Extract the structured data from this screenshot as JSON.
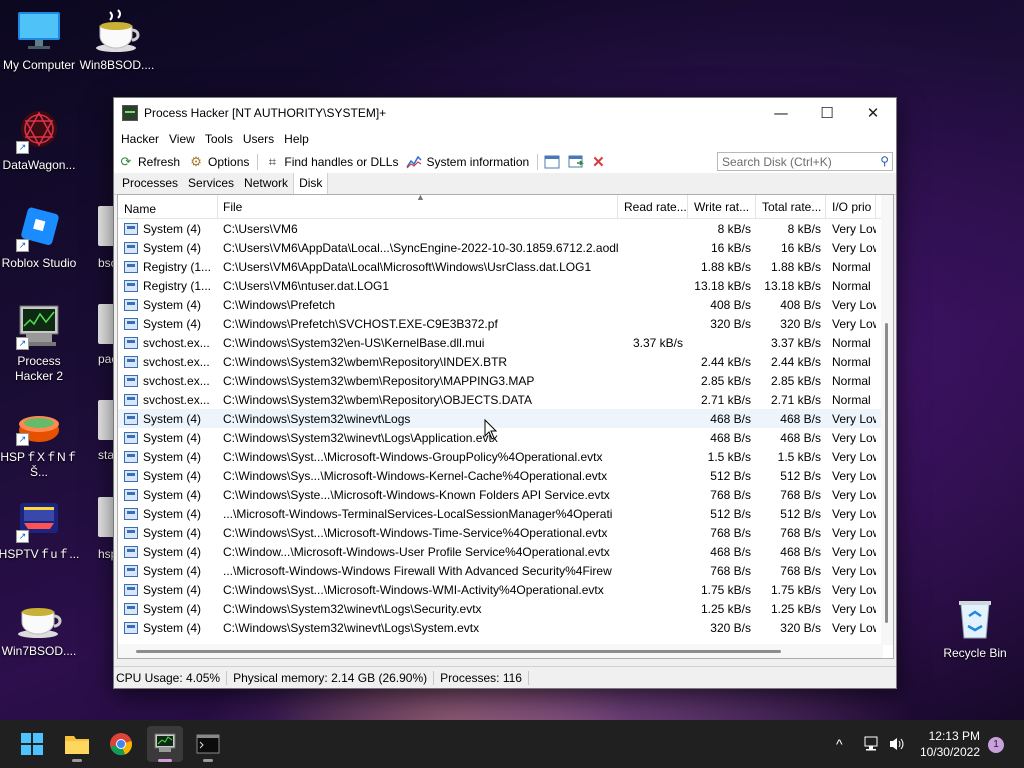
{
  "desktop": {
    "icons": [
      {
        "label": "My Computer"
      },
      {
        "label": "Win8BSOD...."
      },
      {
        "label": "DataWagon..."
      },
      {
        "label": "Roblox Studio"
      },
      {
        "label": "bsods"
      },
      {
        "label": "Process Hacker 2"
      },
      {
        "label": "pac"
      },
      {
        "label": "HSPｆXｆNｆŠ..."
      },
      {
        "label": "sta"
      },
      {
        "label": "HSPTVｆuｆ..."
      },
      {
        "label": "hsp"
      },
      {
        "label": "Win7BSOD...."
      },
      {
        "label": "Recycle Bin"
      }
    ]
  },
  "window": {
    "title": "Process Hacker [NT AUTHORITY\\SYSTEM]+",
    "controls": {
      "minimize": "—",
      "maximize": "☐",
      "close": "✕"
    },
    "menu": [
      "Hacker",
      "View",
      "Tools",
      "Users",
      "Help"
    ],
    "toolbar": {
      "refresh": "Refresh",
      "options": "Options",
      "find_handles": "Find handles or DLLs",
      "system_info": "System information",
      "search_placeholder": "Search Disk (Ctrl+K)"
    },
    "tabs": [
      "Processes",
      "Services",
      "Network",
      "Disk"
    ],
    "active_tab": "Disk",
    "columns": [
      "Name",
      "File",
      "Read rate...",
      "Write rat...",
      "Total rate...",
      "I/O prio"
    ],
    "rows": [
      {
        "name": "System (4)",
        "file": "C:\\Users\\VM6",
        "read": "",
        "write": "8 kB/s",
        "total": "8 kB/s",
        "prio": "Very Low"
      },
      {
        "name": "System (4)",
        "file": "C:\\Users\\VM6\\AppData\\Local...\\SyncEngine-2022-10-30.1859.6712.2.aodl",
        "read": "",
        "write": "16 kB/s",
        "total": "16 kB/s",
        "prio": "Very Low"
      },
      {
        "name": "Registry (1...",
        "file": "C:\\Users\\VM6\\AppData\\Local\\Microsoft\\Windows\\UsrClass.dat.LOG1",
        "read": "",
        "write": "1.88 kB/s",
        "total": "1.88 kB/s",
        "prio": "Normal"
      },
      {
        "name": "Registry (1...",
        "file": "C:\\Users\\VM6\\ntuser.dat.LOG1",
        "read": "",
        "write": "13.18 kB/s",
        "total": "13.18 kB/s",
        "prio": "Normal"
      },
      {
        "name": "System (4)",
        "file": "C:\\Windows\\Prefetch",
        "read": "",
        "write": "408 B/s",
        "total": "408 B/s",
        "prio": "Very Low"
      },
      {
        "name": "System (4)",
        "file": "C:\\Windows\\Prefetch\\SVCHOST.EXE-C9E3B372.pf",
        "read": "",
        "write": "320 B/s",
        "total": "320 B/s",
        "prio": "Very Low"
      },
      {
        "name": "svchost.ex...",
        "file": "C:\\Windows\\System32\\en-US\\KernelBase.dll.mui",
        "read": "3.37 kB/s",
        "write": "",
        "total": "3.37 kB/s",
        "prio": "Normal"
      },
      {
        "name": "svchost.ex...",
        "file": "C:\\Windows\\System32\\wbem\\Repository\\INDEX.BTR",
        "read": "",
        "write": "2.44 kB/s",
        "total": "2.44 kB/s",
        "prio": "Normal"
      },
      {
        "name": "svchost.ex...",
        "file": "C:\\Windows\\System32\\wbem\\Repository\\MAPPING3.MAP",
        "read": "",
        "write": "2.85 kB/s",
        "total": "2.85 kB/s",
        "prio": "Normal"
      },
      {
        "name": "svchost.ex...",
        "file": "C:\\Windows\\System32\\wbem\\Repository\\OBJECTS.DATA",
        "read": "",
        "write": "2.71 kB/s",
        "total": "2.71 kB/s",
        "prio": "Normal"
      },
      {
        "name": "System (4)",
        "file": "C:\\Windows\\System32\\winevt\\Logs",
        "read": "",
        "write": "468 B/s",
        "total": "468 B/s",
        "prio": "Very Low"
      },
      {
        "name": "System (4)",
        "file": "C:\\Windows\\System32\\winevt\\Logs\\Application.evtx",
        "read": "",
        "write": "468 B/s",
        "total": "468 B/s",
        "prio": "Very Low"
      },
      {
        "name": "System (4)",
        "file": "C:\\Windows\\Syst...\\Microsoft-Windows-GroupPolicy%4Operational.evtx",
        "read": "",
        "write": "1.5 kB/s",
        "total": "1.5 kB/s",
        "prio": "Very Low"
      },
      {
        "name": "System (4)",
        "file": "C:\\Windows\\Sys...\\Microsoft-Windows-Kernel-Cache%4Operational.evtx",
        "read": "",
        "write": "512 B/s",
        "total": "512 B/s",
        "prio": "Very Low"
      },
      {
        "name": "System (4)",
        "file": "C:\\Windows\\Syste...\\Microsoft-Windows-Known Folders API Service.evtx",
        "read": "",
        "write": "768 B/s",
        "total": "768 B/s",
        "prio": "Very Low"
      },
      {
        "name": "System (4)",
        "file": "...\\Microsoft-Windows-TerminalServices-LocalSessionManager%4Operati",
        "read": "",
        "write": "512 B/s",
        "total": "512 B/s",
        "prio": "Very Low"
      },
      {
        "name": "System (4)",
        "file": "C:\\Windows\\Syst...\\Microsoft-Windows-Time-Service%4Operational.evtx",
        "read": "",
        "write": "768 B/s",
        "total": "768 B/s",
        "prio": "Very Low"
      },
      {
        "name": "System (4)",
        "file": "C:\\Window...\\Microsoft-Windows-User Profile Service%4Operational.evtx",
        "read": "",
        "write": "468 B/s",
        "total": "468 B/s",
        "prio": "Very Low"
      },
      {
        "name": "System (4)",
        "file": "...\\Microsoft-Windows-Windows Firewall With Advanced Security%4Firew",
        "read": "",
        "write": "768 B/s",
        "total": "768 B/s",
        "prio": "Very Low"
      },
      {
        "name": "System (4)",
        "file": "C:\\Windows\\Syst...\\Microsoft-Windows-WMI-Activity%4Operational.evtx",
        "read": "",
        "write": "1.75 kB/s",
        "total": "1.75 kB/s",
        "prio": "Very Low"
      },
      {
        "name": "System (4)",
        "file": "C:\\Windows\\System32\\winevt\\Logs\\Security.evtx",
        "read": "",
        "write": "1.25 kB/s",
        "total": "1.25 kB/s",
        "prio": "Very Low"
      },
      {
        "name": "System (4)",
        "file": "C:\\Windows\\System32\\winevt\\Logs\\System.evtx",
        "read": "",
        "write": "320 B/s",
        "total": "320 B/s",
        "prio": "Very Low"
      }
    ],
    "status": {
      "cpu": "CPU Usage: 4.05%",
      "memory": "Physical memory: 2.14 GB (26.90%)",
      "processes": "Processes: 116"
    }
  },
  "taskbar": {
    "apps": [
      {
        "icon": "start-icon"
      },
      {
        "icon": "file-explorer-icon"
      },
      {
        "icon": "chrome-icon"
      },
      {
        "icon": "process-hacker-icon"
      },
      {
        "icon": "terminal-icon"
      }
    ],
    "tray": {
      "chevron": "^"
    },
    "time": "12:13 PM",
    "date": "10/30/2022",
    "notification_count": "1"
  },
  "colors": {
    "accent": "#d59ad9",
    "taskbar": "#202020",
    "close_red": "#d83b3b"
  }
}
